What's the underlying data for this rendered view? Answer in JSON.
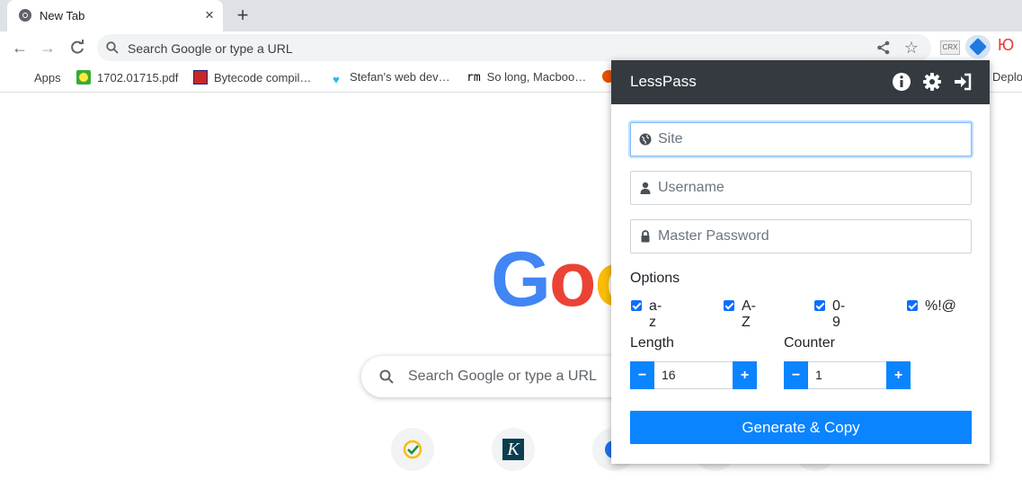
{
  "tab": {
    "title": "New Tab"
  },
  "omnibox": {
    "placeholder": "Search Google or type a URL"
  },
  "extensions": {
    "crx_label": "CRX",
    "yu_label": "Ю"
  },
  "bookmarks": [
    {
      "label": "Apps",
      "icon": "apps-grid-icon"
    },
    {
      "label": "1702.01715.pdf",
      "icon": "smiley-icon"
    },
    {
      "label": "Bytecode compil…",
      "icon": "bytecode-icon"
    },
    {
      "label": "Stefan's web dev…",
      "icon": "heart-icon"
    },
    {
      "label": "So long, Macboo…",
      "icon": "rm-icon",
      "prefix": "rm"
    },
    {
      "label": "Deploy",
      "icon": "deploy-icon"
    }
  ],
  "ntp": {
    "search_placeholder": "Search Google or type a URL"
  },
  "popup": {
    "title": "LessPass",
    "site_placeholder": "Site",
    "username_placeholder": "Username",
    "password_placeholder": "Master Password",
    "options_label": "Options",
    "options": [
      {
        "label": "a-z",
        "checked": true
      },
      {
        "label": "A-Z",
        "checked": true
      },
      {
        "label": "0-9",
        "checked": true
      },
      {
        "label": "%!@",
        "checked": true
      }
    ],
    "length_label": "Length",
    "length_value": "16",
    "counter_label": "Counter",
    "counter_value": "1",
    "minus": "−",
    "plus": "+",
    "generate_label": "Generate & Copy"
  },
  "colors": {
    "accent": "#0a84ff",
    "header": "#343a40"
  }
}
